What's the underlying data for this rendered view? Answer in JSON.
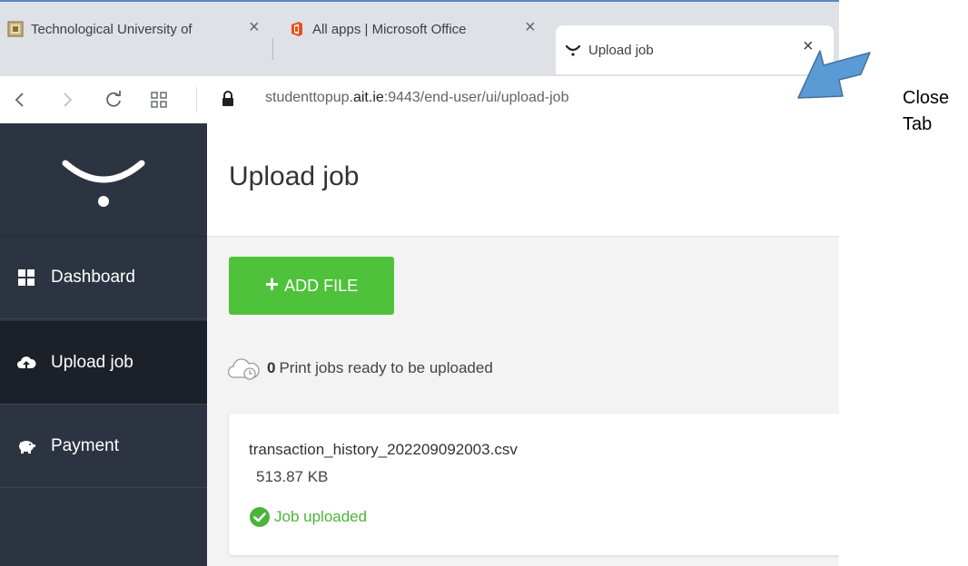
{
  "browser": {
    "tabs": [
      {
        "title": "Technological University of",
        "favicon": "tu-favicon",
        "close": "×"
      },
      {
        "title": "All apps | Microsoft Office",
        "favicon": "office-favicon",
        "close": "×"
      },
      {
        "title": "Upload job",
        "favicon": "ysoft-favicon",
        "close": "×"
      }
    ],
    "url_host": "studenttopup.",
    "url_domain": "ait.ie",
    "url_path": ":9443/end-user/ui/upload-job"
  },
  "sidebar": {
    "items": [
      {
        "label": "Dashboard",
        "icon": "dashboard-icon"
      },
      {
        "label": "Upload job",
        "icon": "cloud-upload-icon"
      },
      {
        "label": "Payment",
        "icon": "piggy-bank-icon"
      }
    ]
  },
  "page": {
    "title": "Upload job",
    "add_file_label": "ADD FILE",
    "ready_count": "0",
    "ready_text": "Print jobs ready to be uploaded"
  },
  "file": {
    "name": "transaction_history_202209092003.csv",
    "size": "513.87 KB",
    "status": "Job uploaded"
  },
  "annotation": {
    "line1": "Close",
    "line2": "Tab"
  },
  "colors": {
    "sidebar": "#2c3442",
    "active_nav": "#1b2029",
    "add_button": "#4ec23a",
    "success": "#4ab539",
    "arrow": "#5b9bd5"
  }
}
